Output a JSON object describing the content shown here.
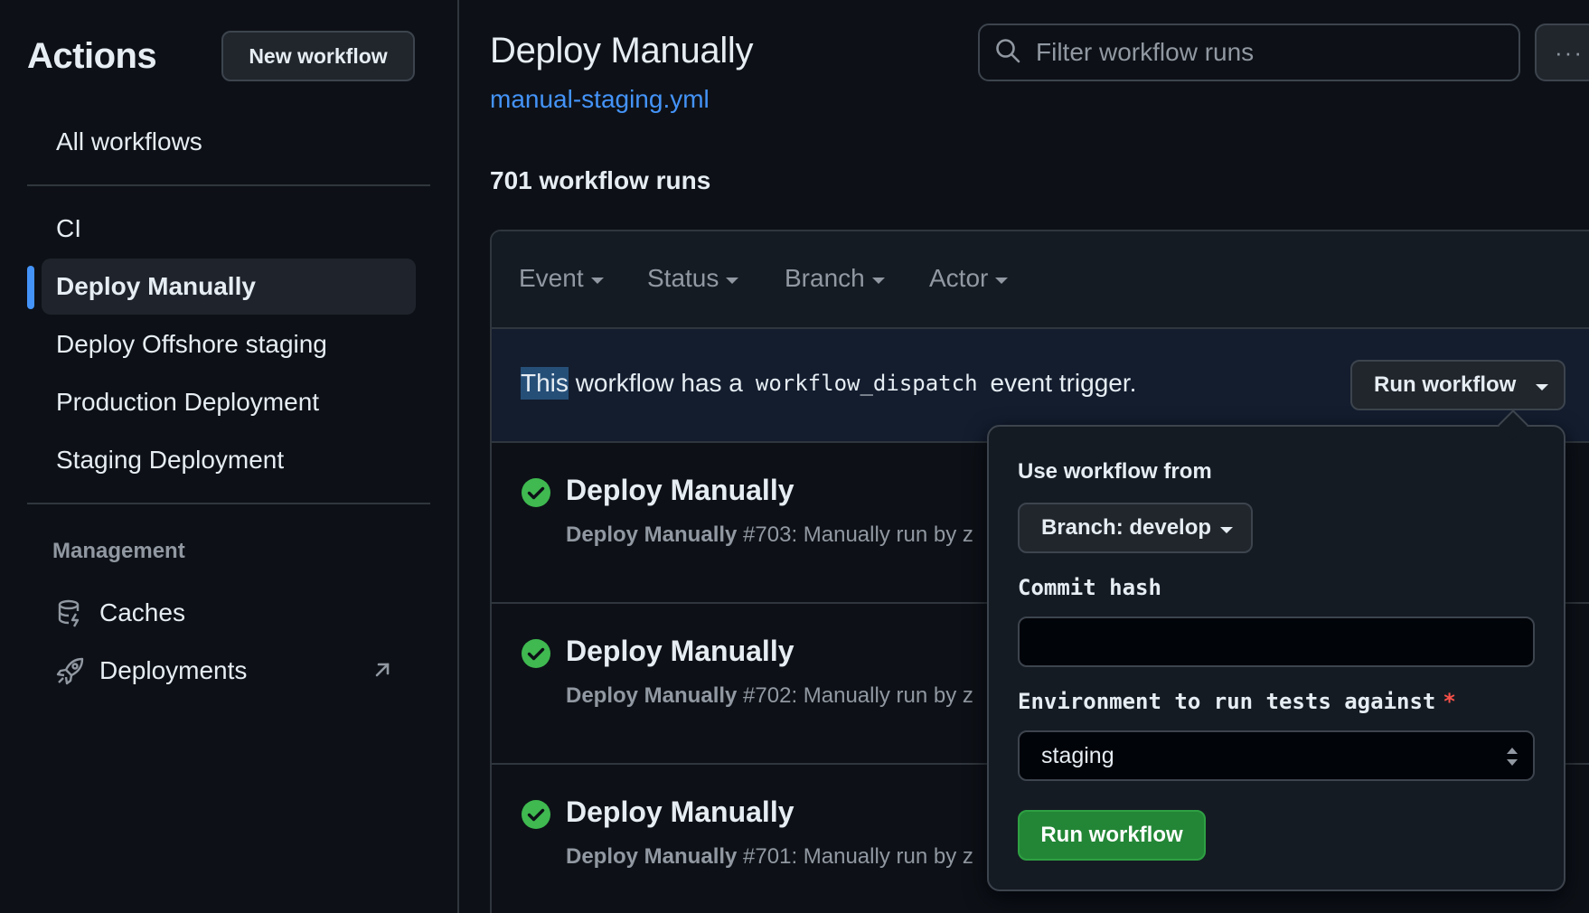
{
  "sidebar": {
    "title": "Actions",
    "new_workflow_label": "New workflow",
    "all_workflows": "All workflows",
    "workflows": [
      "CI",
      "Deploy Manually",
      "Deploy Offshore staging",
      "Production Deployment",
      "Staging Deployment"
    ],
    "active_workflow": "Deploy Manually",
    "management_heading": "Management",
    "management_items": [
      {
        "label": "Caches",
        "icon": "database-icon"
      },
      {
        "label": "Deployments",
        "icon": "rocket-icon"
      }
    ]
  },
  "main": {
    "title": "Deploy Manually",
    "workflow_file": "manual-staging.yml",
    "search_placeholder": "Filter workflow runs",
    "more_label": "···",
    "runs_count": "701 workflow runs",
    "filters": [
      "Event",
      "Status",
      "Branch",
      "Actor"
    ],
    "banner": {
      "highlighted": "This",
      "text_before": "workflow has a",
      "code": "workflow_dispatch",
      "text_after": "event trigger.",
      "button_label": "Run workflow"
    },
    "runs": [
      {
        "title": "Deploy Manually",
        "name": "Deploy Manually",
        "number": "#703: Manually run by z",
        "status": "success"
      },
      {
        "title": "Deploy Manually",
        "name": "Deploy Manually",
        "number": "#702: Manually run by z",
        "status": "success"
      },
      {
        "title": "Deploy Manually",
        "name": "Deploy Manually",
        "number": "#701: Manually run by z",
        "status": "success"
      }
    ]
  },
  "popover": {
    "use_workflow_from": "Use workflow from",
    "branch_label": "Branch: develop",
    "commit_hash_label": "Commit hash",
    "commit_hash_value": "",
    "environment_label": "Environment to run tests against",
    "required_mark": "*",
    "environment_value": "staging",
    "run_button": "Run workflow"
  },
  "colors": {
    "accent": "#4493f8",
    "success": "#3fb950",
    "primary_button": "#238636",
    "required": "#f85149"
  }
}
